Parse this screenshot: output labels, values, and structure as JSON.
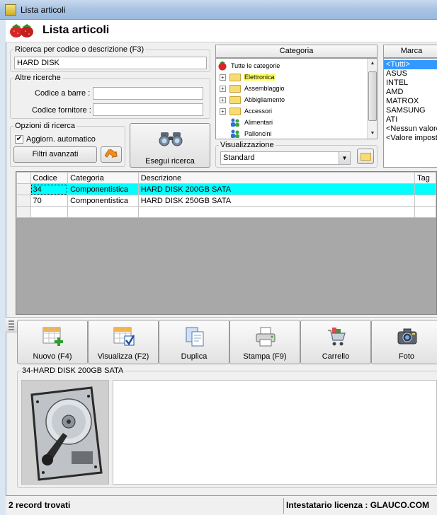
{
  "window": {
    "title": "Lista articoli"
  },
  "header": {
    "title": "Lista articoli"
  },
  "search": {
    "legend": "Ricerca per codice o descrizione (F3)",
    "value": "HARD DISK"
  },
  "other_search": {
    "legend": "Altre ricerche",
    "barcode_label": "Codice a barre :",
    "barcode_value": "",
    "supplier_label": "Codice fornitore :",
    "supplier_value": ""
  },
  "options": {
    "legend": "Opzioni di ricerca",
    "auto_update_label": "Aggiorn. automatico",
    "auto_update_checked": true,
    "advanced_filters_label": "Filtri avanzati"
  },
  "search_button_label": "Esegui ricerca",
  "category": {
    "header": "Categoria",
    "root": "Tutte le categorie",
    "items": [
      {
        "label": "Elettronica",
        "type": "folder",
        "expandable": true,
        "selected": true
      },
      {
        "label": "Assemblaggio",
        "type": "folder",
        "expandable": true
      },
      {
        "label": "Abbigliamento",
        "type": "folder",
        "expandable": true
      },
      {
        "label": "Accessori",
        "type": "folder",
        "expandable": true
      },
      {
        "label": "Alimentari",
        "type": "leaf"
      },
      {
        "label": "Palloncini",
        "type": "leaf"
      }
    ]
  },
  "view": {
    "legend": "Visualizzazione",
    "selected": "Standard"
  },
  "brand": {
    "header": "Marca",
    "items": [
      "<Tutti>",
      "ASUS",
      "INTEL",
      "AMD",
      "MATROX",
      "SAMSUNG",
      "ATI",
      "<Nessun valore>",
      "<Valore impostato>"
    ],
    "selected_index": 0
  },
  "grid": {
    "columns": [
      "Codice",
      "Categoria",
      "Descrizione",
      "Tag"
    ],
    "rows": [
      {
        "codice": "34",
        "categoria": "Componentistica",
        "descrizione": "HARD DISK 200GB SATA"
      },
      {
        "codice": "70",
        "categoria": "Componentistica",
        "descrizione": "HARD DISK 250GB SATA"
      }
    ],
    "highlight_index": 0
  },
  "toolbar": {
    "buttons": [
      {
        "label": "Nuovo (F4)",
        "icon": "new-grid-icon"
      },
      {
        "label": "Visualizza (F2)",
        "icon": "view-grid-icon"
      },
      {
        "label": "Duplica",
        "icon": "duplicate-icon"
      },
      {
        "label": "Stampa (F9)",
        "icon": "printer-icon"
      },
      {
        "label": "Carrello",
        "icon": "cart-icon"
      },
      {
        "label": "Foto",
        "icon": "camera-icon"
      }
    ]
  },
  "preview": {
    "legend": "34-HARD DISK 200GB SATA",
    "image_icon": "hard-disk-photo"
  },
  "status": {
    "records": "2 record trovati",
    "license": "Intestatario licenza : GLAUCO.COM"
  },
  "colors": {
    "highlight_row": "#00ffff",
    "selection": "#3399ff"
  }
}
